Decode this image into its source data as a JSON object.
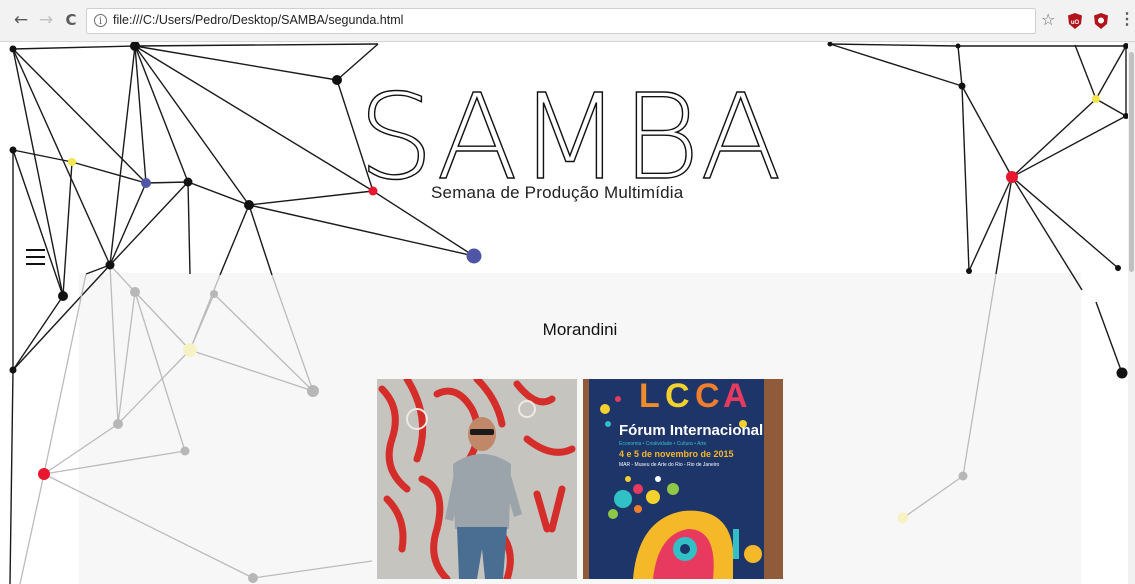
{
  "browser": {
    "back_icon": "←",
    "forward_icon": "→",
    "reload_icon": "C",
    "info_icon": "i",
    "url": "file:///C:/Users/Pedro/Desktop/SAMBA/segunda.html",
    "bookmark_icon": "☆",
    "menu_icon": "⋮"
  },
  "header": {
    "logo_text": "SAMBA",
    "tagline": "Semana de Produção Multimídia"
  },
  "main": {
    "title": "Morandini",
    "photos": [
      {
        "name": "person-photo",
        "alt": "Man leaning on graffiti wall"
      },
      {
        "name": "poster-photo",
        "lines": [
          "Fórum Internacional",
          "Economia • Criatividade • Cultura • Arte",
          "4 e 5 de novembro de 2015",
          "MAR - Museu de Arte do Rio - Rio de Janeiro"
        ]
      }
    ]
  },
  "colors": {
    "accent_red": "#e8172e",
    "accent_blue": "#4f56a6",
    "accent_yellow": "#f2e64b",
    "ink": "#111111"
  }
}
